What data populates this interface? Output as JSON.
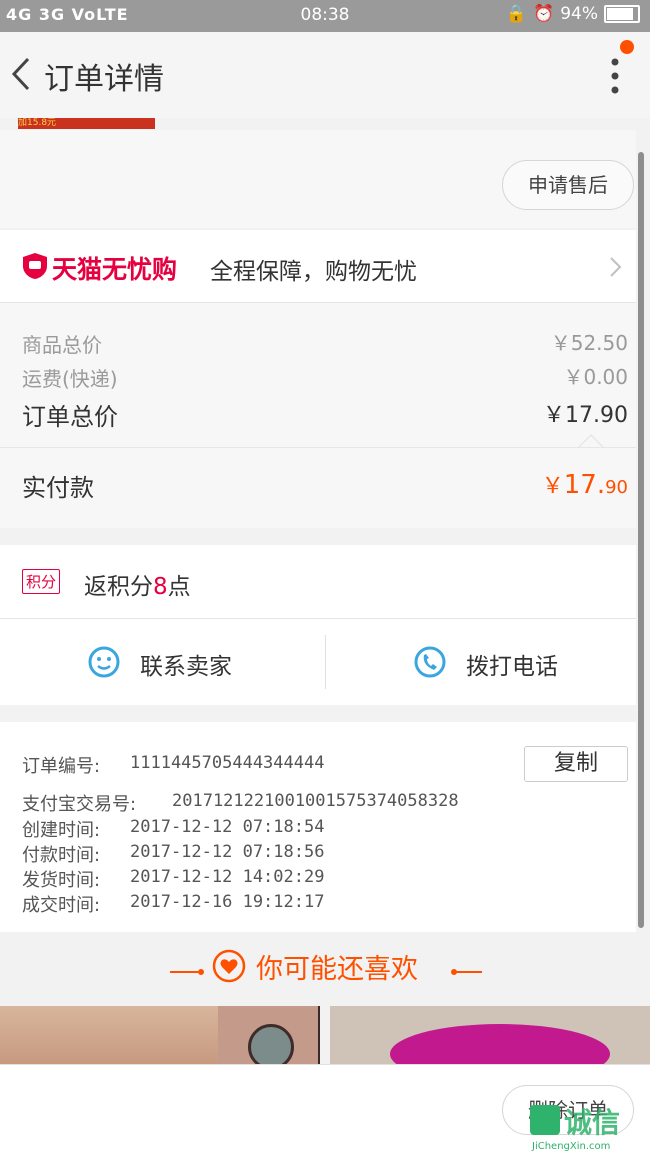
{
  "status_bar": {
    "network": "4G 3G VoLTE",
    "time": "08:38",
    "battery": "94%",
    "battery_level": 0.94
  },
  "nav": {
    "title": "订单详情"
  },
  "banner_text": "加15.8元",
  "after_sale_button": "申请售后",
  "guarantee": {
    "brand": "天猫无忧购",
    "text": "全程保障，购物无忧"
  },
  "pricing": {
    "goods_total_label": "商品总价",
    "goods_total_value": "￥52.50",
    "shipping_label": "运费(快递)",
    "shipping_value": "￥0.00",
    "order_total_label": "订单总价",
    "order_total_value": "￥17.90",
    "paid_label": "实付款",
    "paid_symbol": "￥",
    "paid_int": "17.",
    "paid_dec": "90"
  },
  "points": {
    "badge": "积分",
    "text_prefix": "返积分",
    "points": "8",
    "text_suffix": "点"
  },
  "contact": {
    "seller": "联系卖家",
    "phone": "拨打电话"
  },
  "order_info": {
    "order_no_label": "订单编号:",
    "order_no": "1111445705444344444",
    "copy_button": "复制",
    "alipay_label": "支付宝交易号:",
    "alipay_no": "2017121221001001575374058328",
    "created_label": "创建时间:",
    "created": "2017-12-12 07:18:54",
    "paid_label": "付款时间:",
    "paid": "2017-12-12 07:18:56",
    "shipped_label": "发货时间:",
    "shipped": "2017-12-12 14:02:29",
    "deal_label": "成交时间:",
    "deal": "2017-12-16 19:12:17"
  },
  "recommend_title": "你可能还喜欢",
  "delete_button": "删除订单",
  "watermark": {
    "main": "诚信",
    "sub": "JiChengXin.com"
  },
  "colors": {
    "accent": "#ff5000",
    "tmall_red": "#e5003f",
    "blue_icon": "#3aa6e0"
  }
}
